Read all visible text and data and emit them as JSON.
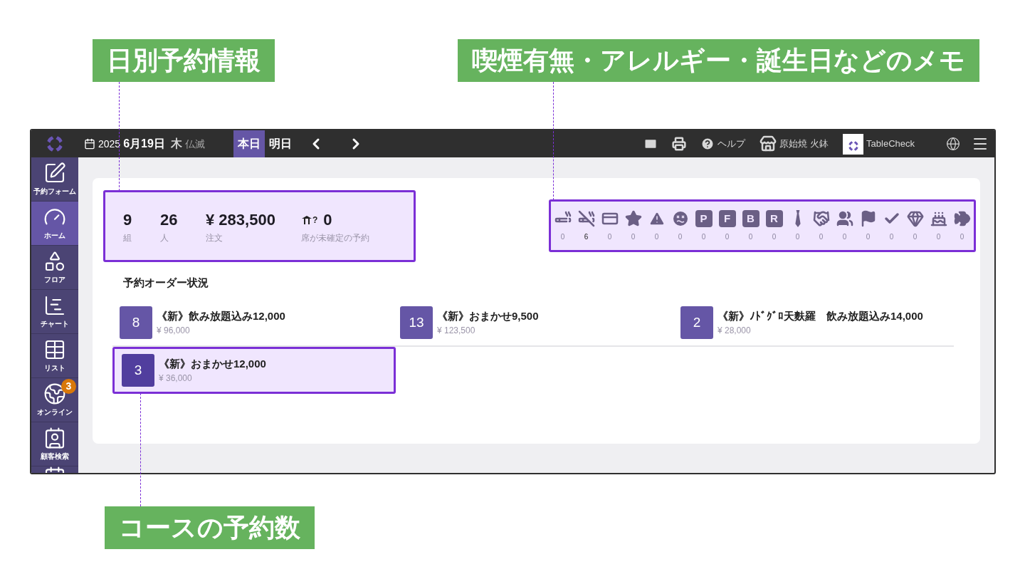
{
  "callouts": [
    {
      "kind": "top-left",
      "label": "日別予約情報"
    },
    {
      "kind": "top-right",
      "label": "喫煙有無・アレルギー・誕生日などのメモ"
    },
    {
      "kind": "bottom",
      "label": "コースの予約数"
    }
  ],
  "topbar": {
    "year": "2025",
    "date": "6月19日",
    "weekday": "木",
    "rokuyo": "仏滅",
    "tabs": [
      {
        "label": "本日",
        "selected": true
      },
      {
        "label": "明日",
        "selected": false
      }
    ],
    "help": "ヘルプ",
    "store": "原始焼 火鉢",
    "account": "TableCheck"
  },
  "sidebar": {
    "items": [
      {
        "kind": "form",
        "label": "予約フォーム",
        "selected": false
      },
      {
        "kind": "home",
        "label": "ホーム",
        "selected": true
      },
      {
        "kind": "floor",
        "label": "フロア",
        "selected": false
      },
      {
        "kind": "chart",
        "label": "チャート",
        "selected": false
      },
      {
        "kind": "list",
        "label": "リスト",
        "selected": false
      },
      {
        "kind": "online",
        "label": "オンライン",
        "selected": false,
        "badge": "3"
      },
      {
        "kind": "customer",
        "label": "顧客検索",
        "selected": false
      }
    ]
  },
  "summary": {
    "highlighted": true,
    "stats": [
      {
        "kind": "plain",
        "value": "9",
        "label": "組"
      },
      {
        "kind": "plain",
        "value": "26",
        "label": "人"
      },
      {
        "kind": "plain",
        "value": "¥ 283,500",
        "label": "注文"
      },
      {
        "kind": "table",
        "icon_mark": "?",
        "value": "0",
        "label": "席が未確定の予約"
      }
    ]
  },
  "memos": {
    "highlighted": true,
    "items": [
      {
        "kind": "smoking",
        "count": "0"
      },
      {
        "kind": "nonsmoking",
        "count": "6"
      },
      {
        "kind": "card",
        "count": "0"
      },
      {
        "kind": "star",
        "count": "0"
      },
      {
        "kind": "warning",
        "count": "0"
      },
      {
        "kind": "dizzy",
        "count": "0"
      },
      {
        "kind": "letter",
        "letter": "P",
        "count": "0"
      },
      {
        "kind": "letter",
        "letter": "F",
        "count": "0"
      },
      {
        "kind": "letter",
        "letter": "B",
        "count": "0"
      },
      {
        "kind": "letter",
        "letter": "R",
        "count": "0"
      },
      {
        "kind": "tie",
        "count": "0"
      },
      {
        "kind": "handshake",
        "count": "0"
      },
      {
        "kind": "group",
        "count": "0"
      },
      {
        "kind": "flag",
        "count": "0"
      },
      {
        "kind": "check",
        "count": "0"
      },
      {
        "kind": "gem",
        "count": "0"
      },
      {
        "kind": "cake",
        "count": "0"
      },
      {
        "kind": "fish",
        "count": "0"
      }
    ]
  },
  "orders": {
    "title": "予約オーダー状況",
    "courses": [
      {
        "count": "8",
        "name": "《新》飲み放題込み12,000",
        "price": "¥ 96,000",
        "highlighted": false
      },
      {
        "count": "13",
        "name": "《新》おまかせ9,500",
        "price": "¥ 123,500",
        "highlighted": false
      },
      {
        "count": "2",
        "name": "《新》ﾉﾄﾞｸﾞﾛ天麩羅　飲み放題込み14,000",
        "price": "¥ 28,000",
        "highlighted": false
      },
      {
        "count": "3",
        "name": "《新》おまかせ12,000",
        "price": "¥ 36,000",
        "highlighted": true
      }
    ]
  }
}
